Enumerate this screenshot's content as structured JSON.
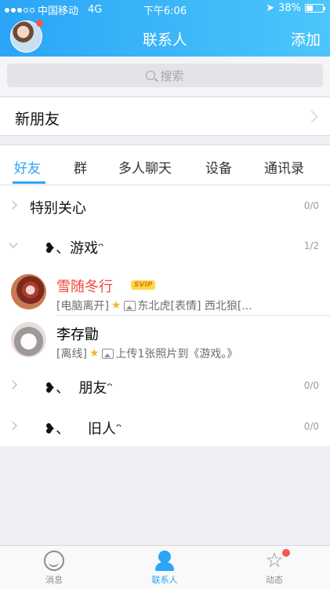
{
  "status_bar": {
    "carrier": "中国移动",
    "network": "4G",
    "time": "下午6:06",
    "battery": "38%",
    "battery_level": 0.38
  },
  "header": {
    "title": "联系人",
    "add_label": "添加"
  },
  "search": {
    "placeholder": "搜索"
  },
  "new_friends": {
    "label": "新朋友"
  },
  "tabs": [
    {
      "label": "好友",
      "active": true
    },
    {
      "label": "群",
      "active": false
    },
    {
      "label": "多人聊天",
      "active": false
    },
    {
      "label": "设备",
      "active": false
    },
    {
      "label": "通讯录",
      "active": false
    }
  ],
  "groups": [
    {
      "name": "特别关心",
      "count": "0/0",
      "expanded": false
    },
    {
      "name": "❥、游戏ᵔ",
      "count": "1/2",
      "expanded": true
    },
    {
      "name": "❥、  朋友ᵔ",
      "count": "0/0",
      "expanded": false
    },
    {
      "name": "❥、    旧人ᵔ",
      "count": "0/0",
      "expanded": false
    }
  ],
  "contacts": [
    {
      "name": "雪随冬行",
      "badge": "SVIP",
      "status": "[电脑离开]",
      "message": "东北虎[表情] 西北狼[..."
    },
    {
      "name": "李存勖",
      "status": "[离线]",
      "message": "上传1张照片到《游戏。》"
    }
  ],
  "tabbar": [
    {
      "label": "消息",
      "icon": "chat-bubble-icon",
      "active": false
    },
    {
      "label": "联系人",
      "icon": "contacts-icon",
      "active": true
    },
    {
      "label": "动态",
      "icon": "star-icon",
      "active": false
    }
  ],
  "colors": {
    "accent": "#2aa5f7",
    "name_highlight": "#f0473d",
    "notify_dot": "#f5594e"
  }
}
